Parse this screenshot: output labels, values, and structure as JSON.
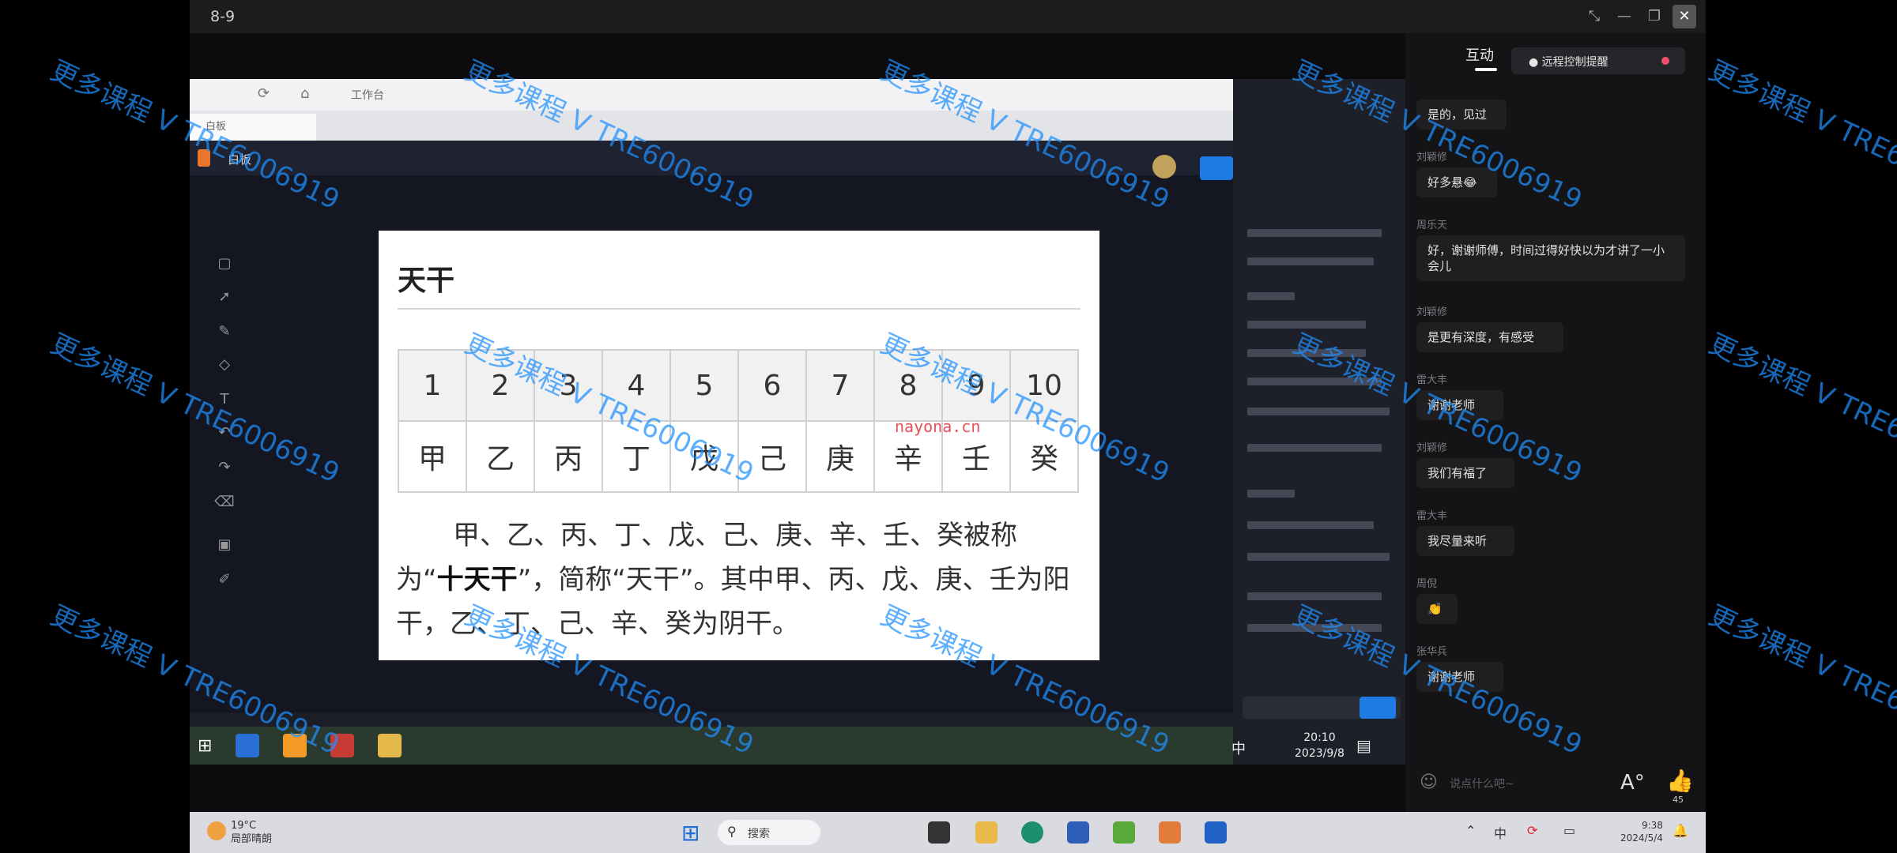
{
  "window": {
    "title": "8-9"
  },
  "inner_browser": {
    "tab_title": "白板",
    "workbench": "工作台"
  },
  "inner_app": {
    "name": "白板"
  },
  "slide": {
    "title": "天干",
    "numbers": [
      "1",
      "2",
      "3",
      "4",
      "5",
      "6",
      "7",
      "8",
      "9",
      "10"
    ],
    "stems": [
      "甲",
      "乙",
      "丙",
      "丁",
      "戊",
      "己",
      "庚",
      "辛",
      "壬",
      "癸"
    ],
    "paragraph_1": "甲、乙、丙、丁、戊、己、庚、辛、壬、癸被称为“",
    "paragraph_bold": "十天干",
    "paragraph_2": "”，简称“天干”。其中甲、丙、戊、庚、壬为阳干，乙、丁、己、辛、癸为阴干。"
  },
  "inner_taskbar": {
    "time": "20:10",
    "date": "2023/9/8",
    "ime": "中"
  },
  "chat": {
    "tab": "互动",
    "remote_control": "远程控制提醒",
    "messages": [
      {
        "name": "",
        "text": "是的，见过"
      },
      {
        "name": "刘颖修",
        "text": "好多悬😂"
      },
      {
        "name": "周乐天",
        "text": "好，谢谢师傅，时间过得好快以为才讲了一小会儿"
      },
      {
        "name": "刘颖修",
        "text": "是更有深度，有感受"
      },
      {
        "name": "雷大丰",
        "text": "谢谢老师"
      },
      {
        "name": "刘颖修",
        "text": "我们有福了"
      },
      {
        "name": "雷大丰",
        "text": "我尽量来听"
      },
      {
        "name": "周倪",
        "text": "👏"
      },
      {
        "name": "张华兵",
        "text": "谢谢老师"
      }
    ],
    "input_placeholder": "说点什么吧~",
    "like_count": "45"
  },
  "host_taskbar": {
    "weather_temp": "19°C",
    "weather_desc": "局部晴朗",
    "search": "搜索",
    "time": "9:38",
    "date": "2024/5/4"
  },
  "watermark": "更多课程 V TRE6006919",
  "site_mark": "nayona.cn",
  "colors": {
    "watermark": "#1e90ff",
    "accent": "#1d7be3"
  }
}
